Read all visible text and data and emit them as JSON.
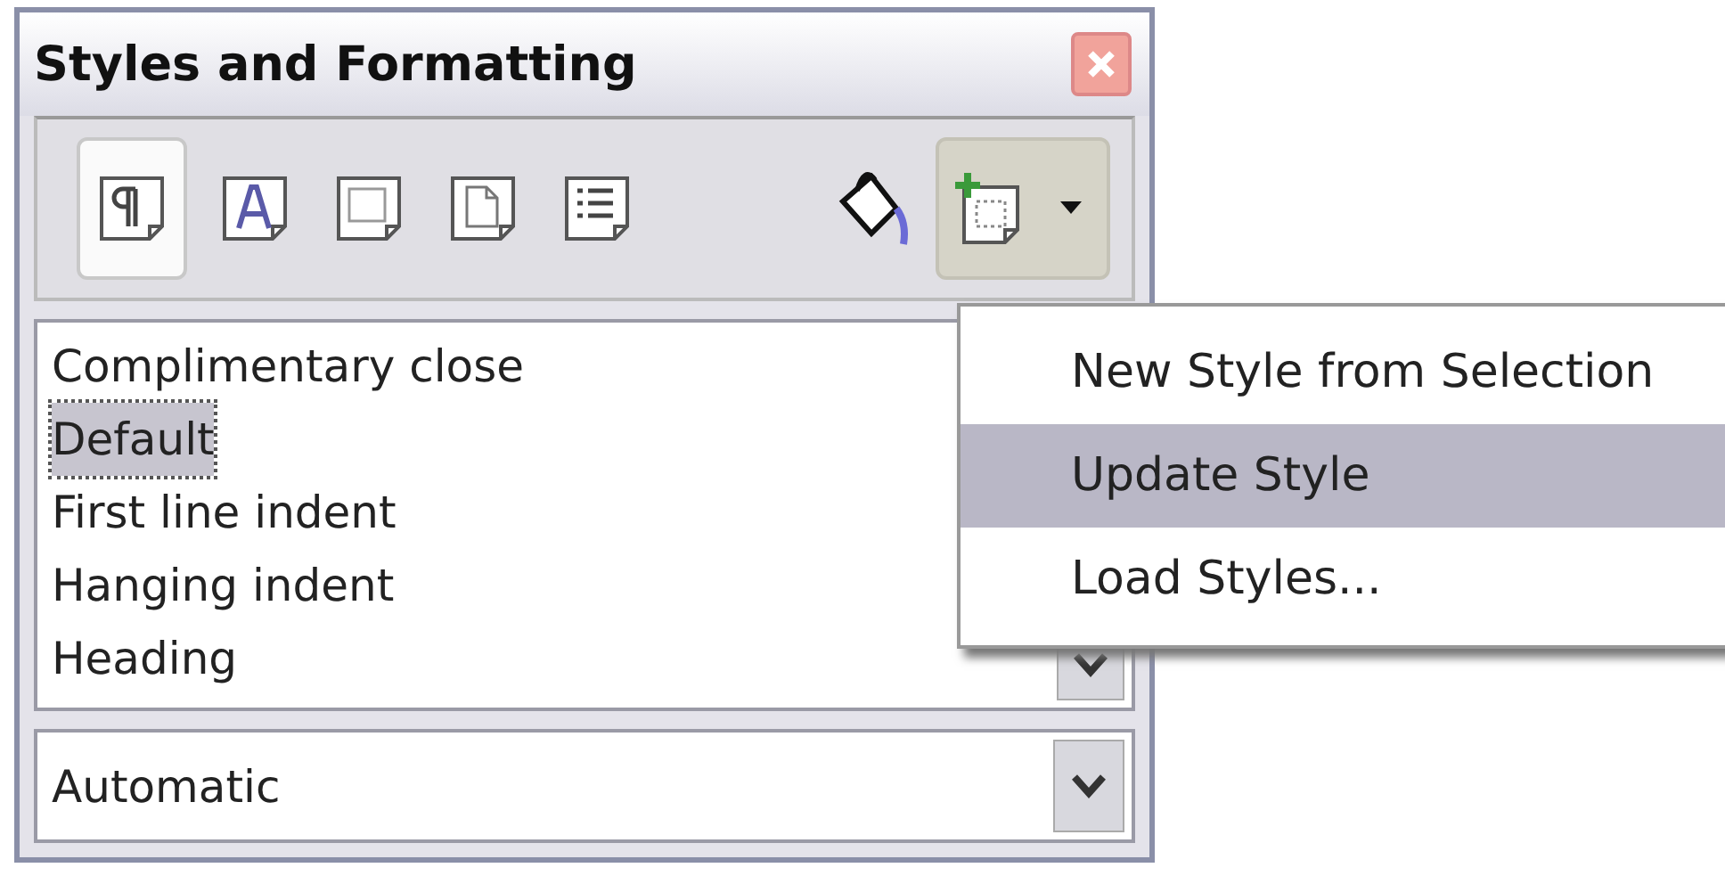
{
  "window": {
    "title": "Styles and Formatting"
  },
  "style_families": [
    {
      "kind": "paragraph",
      "selected": true
    },
    {
      "kind": "character",
      "selected": false
    },
    {
      "kind": "frame",
      "selected": false
    },
    {
      "kind": "page",
      "selected": false
    },
    {
      "kind": "list",
      "selected": false
    }
  ],
  "new_style_button": {
    "pressed": true
  },
  "styles": [
    {
      "label": "Complimentary close",
      "selected": false
    },
    {
      "label": "Default",
      "selected": true
    },
    {
      "label": "First line indent",
      "selected": false
    },
    {
      "label": "Hanging indent",
      "selected": false
    },
    {
      "label": "Heading",
      "selected": false
    }
  ],
  "filter": {
    "value": "Automatic"
  },
  "menu": [
    {
      "label": "New Style from Selection",
      "selected": false
    },
    {
      "label": "Update Style",
      "selected": true
    },
    {
      "label": "Load Styles...",
      "selected": false
    }
  ]
}
